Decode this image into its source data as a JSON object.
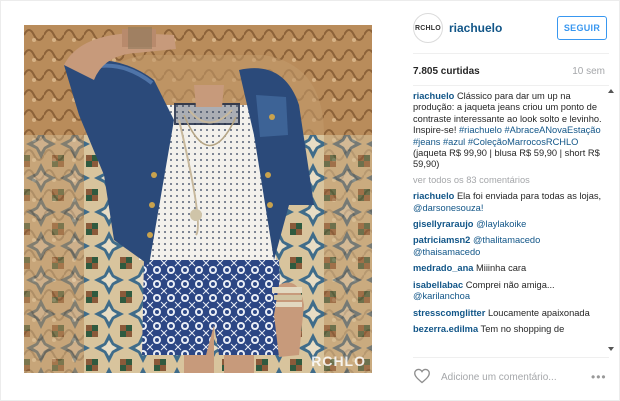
{
  "post": {
    "username": "riachuelo",
    "avatar_text": "RCHLO",
    "follow_label": "SEGUIR",
    "likes": "7.805 curtidas",
    "time": "10 sem",
    "watermark": "RCHLO",
    "caption": {
      "author": "riachuelo",
      "text_a": "Clássico para dar um up na produção: a jaqueta jeans criou um ponto de contraste interessante ao look solto e levinho. Inspire-se! ",
      "tags": [
        "#riachuelo",
        "#AbraceANovaEstação",
        "#jeans",
        "#azul",
        "#ColeçãoMarrocosRCHLO"
      ],
      "text_b": " (jaqueta R$ 99,90 | blusa R$ 59,90 | short R$ 59,90)"
    },
    "view_all": "ver todos os 83 comentários",
    "comments": [
      {
        "author": "riachuelo",
        "text": "Ela foi enviada para todas as lojas, ",
        "mention": "@darsonesouza!"
      },
      {
        "author": "gisellyraraujo",
        "text": "",
        "mention": "@laylakoike"
      },
      {
        "author": "patriciamsn2",
        "text": "",
        "mention": "@thalitamacedo @thaisamacedo"
      },
      {
        "author": "medrado_ana",
        "text": "Miiinha cara",
        "mention": ""
      },
      {
        "author": "isabellabac",
        "text": "Comprei não amiga... ",
        "mention": "@karilanchoa"
      },
      {
        "author": "stresscomglitter",
        "text": "Loucamente apaixonada",
        "mention": ""
      },
      {
        "author": "bezerra.edilma",
        "text": "Tem no shopping de",
        "mention": ""
      }
    ],
    "comment_placeholder": "Adicione um comentário...",
    "more_label": "•••"
  },
  "colors": {
    "link_blue": "#125688",
    "follow_blue": "#3897f0",
    "muted_gray": "#a5a7aa",
    "denim": "#2b4a7a"
  },
  "icons": [
    "heart-icon",
    "more-options-icon",
    "scroll-up-icon",
    "scroll-down-icon"
  ]
}
